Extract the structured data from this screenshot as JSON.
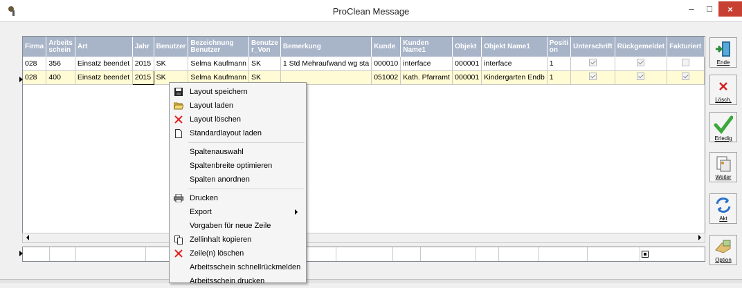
{
  "window": {
    "title": "ProClean Message",
    "minimize": "–",
    "maximize": "□",
    "close": "×"
  },
  "grid": {
    "columns": [
      "Firma",
      "Arbeits schein",
      "Art",
      "Jahr",
      "Benutzer",
      "Bezeichnung Benutzer",
      "Benutze r_Von",
      "Bemerkung",
      "Kunde",
      "Kunden Name1",
      "Objekt",
      "Objekt Name1",
      "Positi on",
      "Unterschrift",
      "Rückgemeldet",
      "Fakturiert"
    ],
    "rows": [
      {
        "firma": "028",
        "arbeitsschein": "356",
        "art": "Einsatz beendet",
        "jahr": "2015",
        "benutzer": "SK",
        "bezeichnung": "Selma Kaufmann",
        "benutzer_von": "SK",
        "bemerkung": "1 Std  Mehraufwand wg sta",
        "kunde": "000010",
        "kunden_name1": "interface",
        "objekt": "000001",
        "objekt_name1": "interface",
        "position": "1",
        "unterschrift": true,
        "rueckgemeldet": true,
        "fakturiert": false
      },
      {
        "firma": "028",
        "arbeitsschein": "400",
        "art": "Einsatz beendet",
        "jahr": "2015",
        "benutzer": "SK",
        "bezeichnung": "Selma Kaufmann",
        "benutzer_von": "SK",
        "bemerkung": "",
        "kunde": "051002",
        "kunden_name1": "Kath. Pfarramt",
        "objekt": "000001",
        "objekt_name1": "Kindergarten Endb",
        "position": "1",
        "unterschrift": true,
        "rueckgemeldet": true,
        "fakturiert": true
      }
    ]
  },
  "sidebar": {
    "ende": "Ende",
    "loesch": "Lösch.",
    "erledig": "Erledig",
    "weiter": "Weiter",
    "akt": "Akt",
    "option": "Option"
  },
  "context_menu": {
    "items": [
      "Layout speichern",
      "Layout laden",
      "Layout löschen",
      "Standardlayout laden",
      "Spaltenauswahl",
      "Spaltenbreite optimieren",
      "Spalten anordnen",
      "Drucken",
      "Export",
      "Vorgaben für neue Zeile",
      "Zellinhalt kopieren",
      "Zeile(n) löschen",
      "Arbeitsschein schnellrückmelden",
      "Arbeitsschein drucken"
    ]
  },
  "colors": {
    "header_bg": "#a8b4c8",
    "selected_row": "#fffbd4",
    "close_button": "#c84031"
  }
}
